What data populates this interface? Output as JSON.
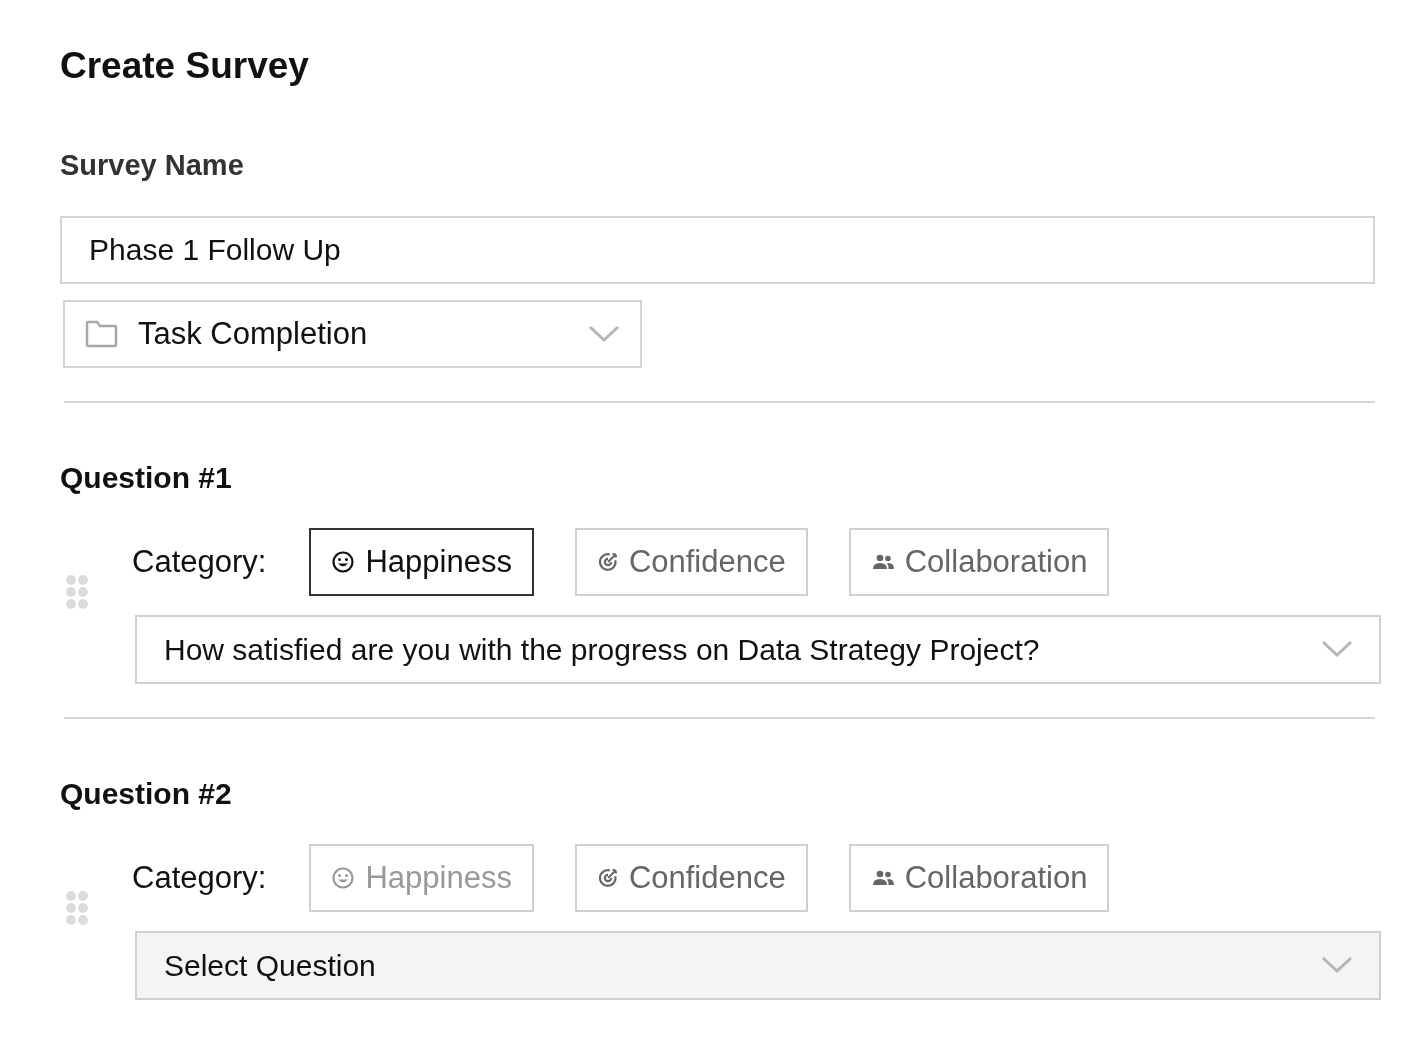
{
  "title": "Create Survey",
  "survey_name": {
    "label": "Survey Name",
    "value": "Phase 1 Follow Up"
  },
  "folder_select": {
    "value": "Task Completion"
  },
  "questions": [
    {
      "heading": "Question #1",
      "category_label": "Category:",
      "categories": [
        {
          "kind": "happiness",
          "label": "Happiness",
          "selected": true,
          "disabled": false
        },
        {
          "kind": "confidence",
          "label": "Confidence",
          "selected": false,
          "disabled": false
        },
        {
          "kind": "collaboration",
          "label": "Collaboration",
          "selected": false,
          "disabled": false
        }
      ],
      "question_select": {
        "value": "How satisfied are you with the progress on Data Strategy Project?"
      }
    },
    {
      "heading": "Question #2",
      "category_label": "Category:",
      "categories": [
        {
          "kind": "happiness",
          "label": "Happiness",
          "selected": false,
          "disabled": true
        },
        {
          "kind": "confidence",
          "label": "Confidence",
          "selected": false,
          "disabled": false
        },
        {
          "kind": "collaboration",
          "label": "Collaboration",
          "selected": false,
          "disabled": false
        }
      ],
      "question_select": {
        "placeholder": "Select Question"
      }
    }
  ]
}
